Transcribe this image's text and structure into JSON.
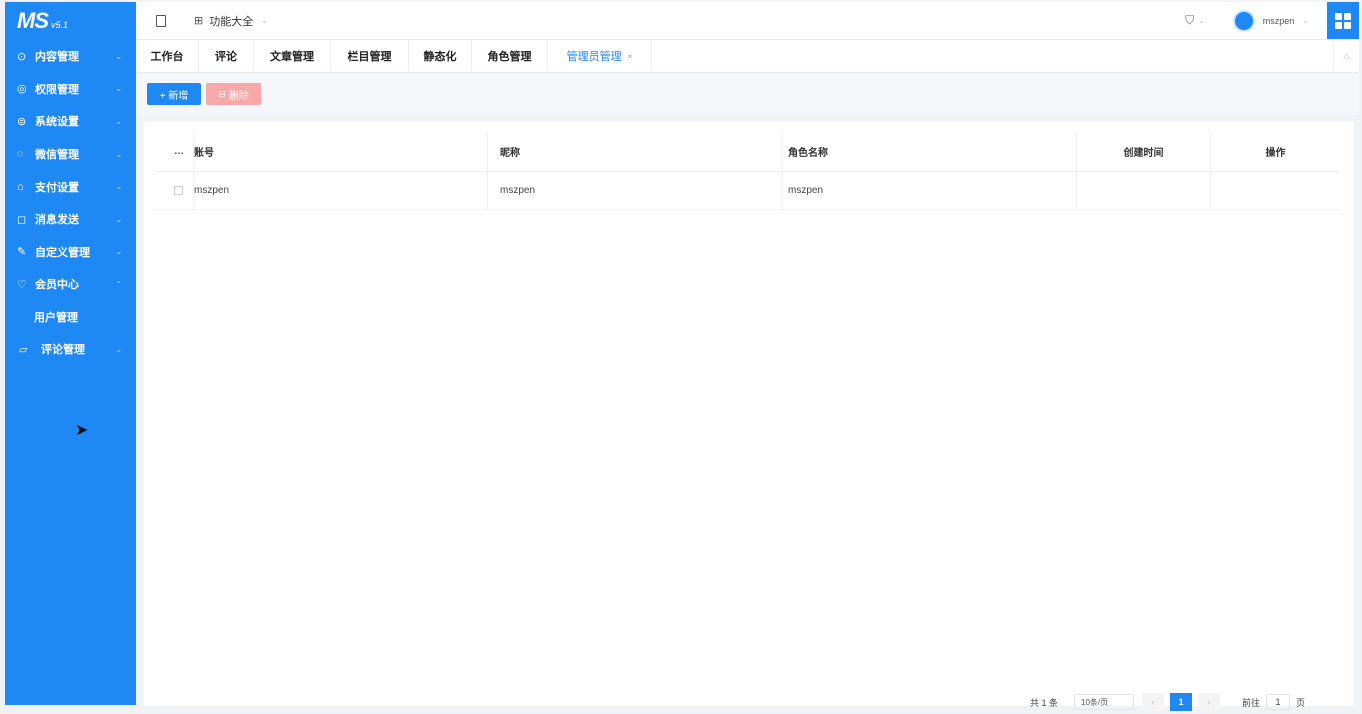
{
  "app": {
    "brand": "MS",
    "version": "v5.1"
  },
  "sidebar": {
    "items": [
      {
        "label": "内容管理",
        "icon": "○"
      },
      {
        "label": "权限管理",
        "icon": "○"
      },
      {
        "label": "系统设置",
        "icon": "○"
      },
      {
        "label": "微信管理",
        "icon": "○"
      },
      {
        "label": "支付设置",
        "icon": "○"
      },
      {
        "label": "消息发送",
        "icon": "○"
      },
      {
        "label": "自定义管理",
        "icon": "○"
      },
      {
        "label": "会员中心",
        "icon": "○"
      }
    ],
    "sub_item": "用户管理",
    "last_item": {
      "label": "评论管理",
      "icon": "○"
    }
  },
  "header": {
    "breadcrumb": "功能大全",
    "username": "mszpen"
  },
  "tabs": [
    {
      "label": "工作台",
      "width": 63
    },
    {
      "label": "评论",
      "width": 55
    },
    {
      "label": "文章管理",
      "width": 77
    },
    {
      "label": "栏目管理",
      "width": 78
    },
    {
      "label": "静态化",
      "width": 63
    },
    {
      "label": "角色管理",
      "width": 76
    },
    {
      "label": "管理员管理",
      "width": 104
    }
  ],
  "toolbar": {
    "add_label": "+ 新增",
    "delete_label": "删除"
  },
  "table": {
    "columns": [
      "账号",
      "昵称",
      "角色名称",
      "创建时间",
      "操作"
    ],
    "rows": [
      {
        "account": "mszpen",
        "nickname": "mszpen",
        "role": "mszpen",
        "created": "",
        "ops": ""
      }
    ]
  },
  "pagination": {
    "total": "共 1 条",
    "page_size": "10条/页",
    "current": "1",
    "goto_label": "前往",
    "goto_value": "1",
    "unit": "页"
  },
  "colors": {
    "primary": "#1e88f5",
    "danger_light": "#f7a9a9"
  }
}
